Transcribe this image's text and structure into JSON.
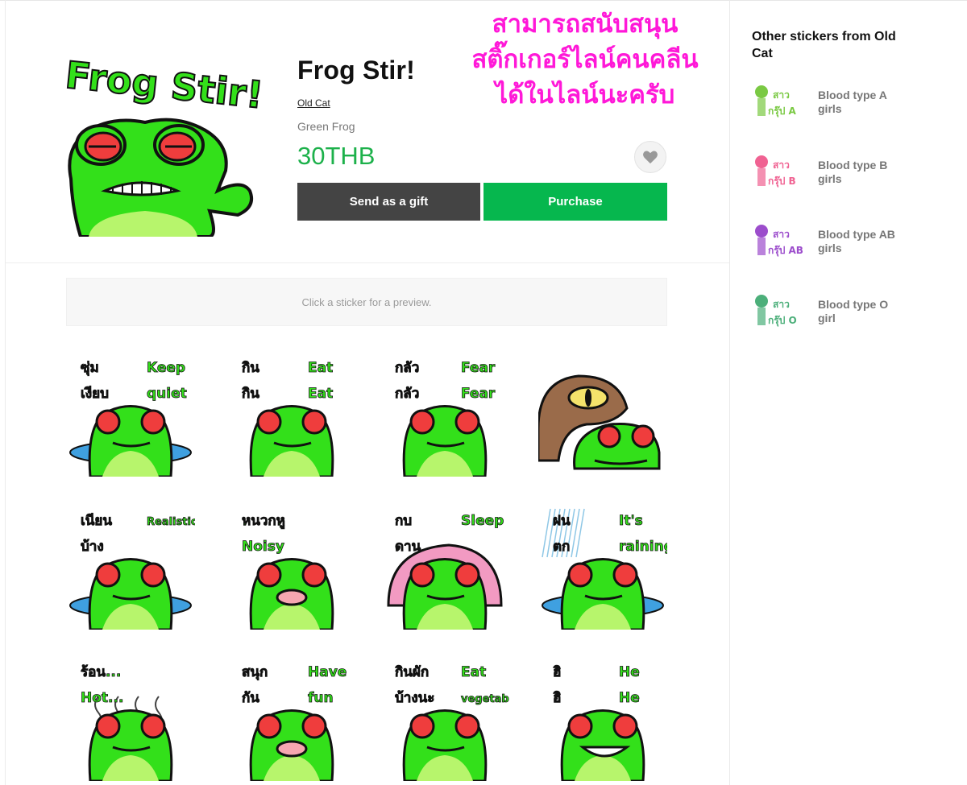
{
  "product": {
    "title": "Frog Stir!",
    "author": "Old Cat",
    "subtitle": "Green Frog",
    "price": "30THB",
    "main_image_text": "Frog Stir!"
  },
  "buttons": {
    "gift": "Send as a gift",
    "purchase": "Purchase",
    "favorite_icon": "heart-icon"
  },
  "promo": {
    "lines": [
      "สามารถสนับสนุน",
      "สติ๊กเกอร์ไลน์คนคลีน",
      "ได้ในไลน์นะครับ"
    ],
    "color": "#ff18d8"
  },
  "preview": {
    "hint": "Click a sticker for a preview."
  },
  "stickers": [
    {
      "captions": [
        "ซุ่ม",
        "เงียบ",
        "Keep",
        "quiet"
      ]
    },
    {
      "captions": [
        "กิน",
        "กิน",
        "Eat",
        "Eat"
      ]
    },
    {
      "captions": [
        "กลัว",
        "กลัว",
        "Fear",
        "Fear"
      ]
    },
    {
      "captions": []
    },
    {
      "captions": [
        "เนียน",
        "บ้าง",
        "Realistically"
      ]
    },
    {
      "captions": [
        "หนวกหู",
        "Noisy"
      ]
    },
    {
      "captions": [
        "กบ",
        "ดาน",
        "Sleep"
      ]
    },
    {
      "captions": [
        "ฝน",
        "ตก",
        "It's",
        "raining"
      ]
    },
    {
      "captions": [
        "ร้อน...",
        "Hot..."
      ]
    },
    {
      "captions": [
        "สนุก",
        "กัน",
        "Have",
        "fun"
      ]
    },
    {
      "captions": [
        "กินผัก",
        "บ้างนะ",
        "Eat",
        "vegetables"
      ]
    },
    {
      "captions": [
        "ฮิ",
        "ฮิ",
        "He",
        "He"
      ]
    }
  ],
  "sidebar": {
    "title": "Other stickers from Old Cat",
    "items": [
      {
        "name": "Blood type A girls",
        "thumb_text": [
          "สาว",
          "กรุ๊ป A"
        ],
        "thumb_color": "#7ac943"
      },
      {
        "name": "Blood type B girls",
        "thumb_text": [
          "สาว",
          "กรุ๊ป B"
        ],
        "thumb_color": "#f06292"
      },
      {
        "name": "Blood type AB girls",
        "thumb_text": [
          "สาว",
          "กรุ๊ป AB"
        ],
        "thumb_color": "#9c4dcc"
      },
      {
        "name": "Blood type O girl",
        "thumb_text": [
          "สาว",
          "กรุ๊ป O"
        ],
        "thumb_color": "#4caf7a"
      }
    ]
  },
  "colors": {
    "frog_green": "#33e01a",
    "price_green": "#1db14b",
    "purchase_green": "#06b74e",
    "gift_gray": "#444444"
  }
}
